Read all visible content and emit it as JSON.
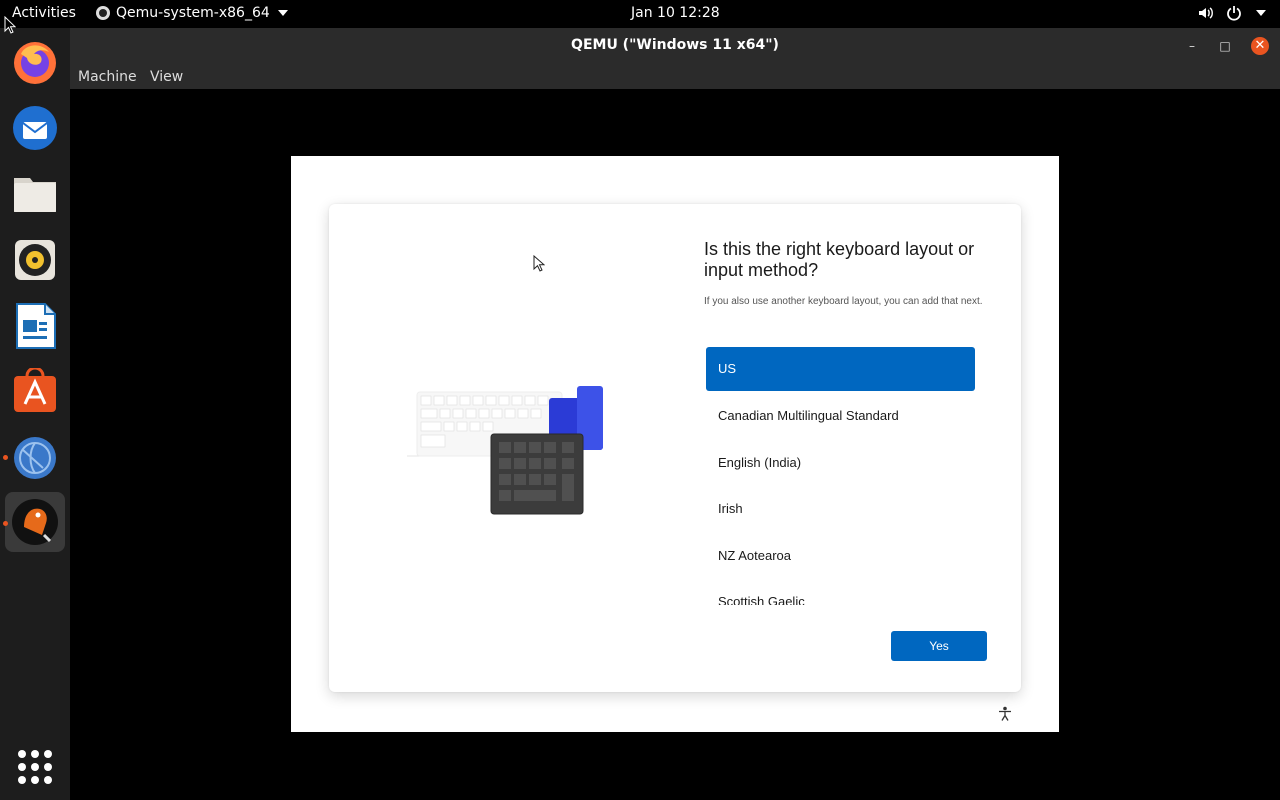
{
  "topbar": {
    "activities": "Activities",
    "app_name": "Qemu-system-x86_64",
    "clock": "Jan 10  12:28"
  },
  "dock": {
    "apps": [
      "firefox-icon",
      "thunderbird-icon",
      "files-icon",
      "rhythmbox-icon",
      "libreoffice-writer-icon",
      "ubuntu-software-icon",
      "network-app-icon",
      "qemu-icon"
    ]
  },
  "window": {
    "title": "QEMU (\"Windows 11 x64\")",
    "menu": {
      "machine": "Machine",
      "view": "View"
    }
  },
  "oobe": {
    "heading": "Is this the right keyboard layout or input method?",
    "subtext": "If you also use another keyboard layout, you can add that next.",
    "options": [
      {
        "label": "US",
        "selected": true
      },
      {
        "label": "Canadian Multilingual Standard",
        "selected": false
      },
      {
        "label": "English (India)",
        "selected": false
      },
      {
        "label": "Irish",
        "selected": false
      },
      {
        "label": "NZ Aotearoa",
        "selected": false
      },
      {
        "label": "Scottish Gaelic",
        "selected": false
      }
    ],
    "yes_label": "Yes",
    "accent": "#0067c0"
  }
}
